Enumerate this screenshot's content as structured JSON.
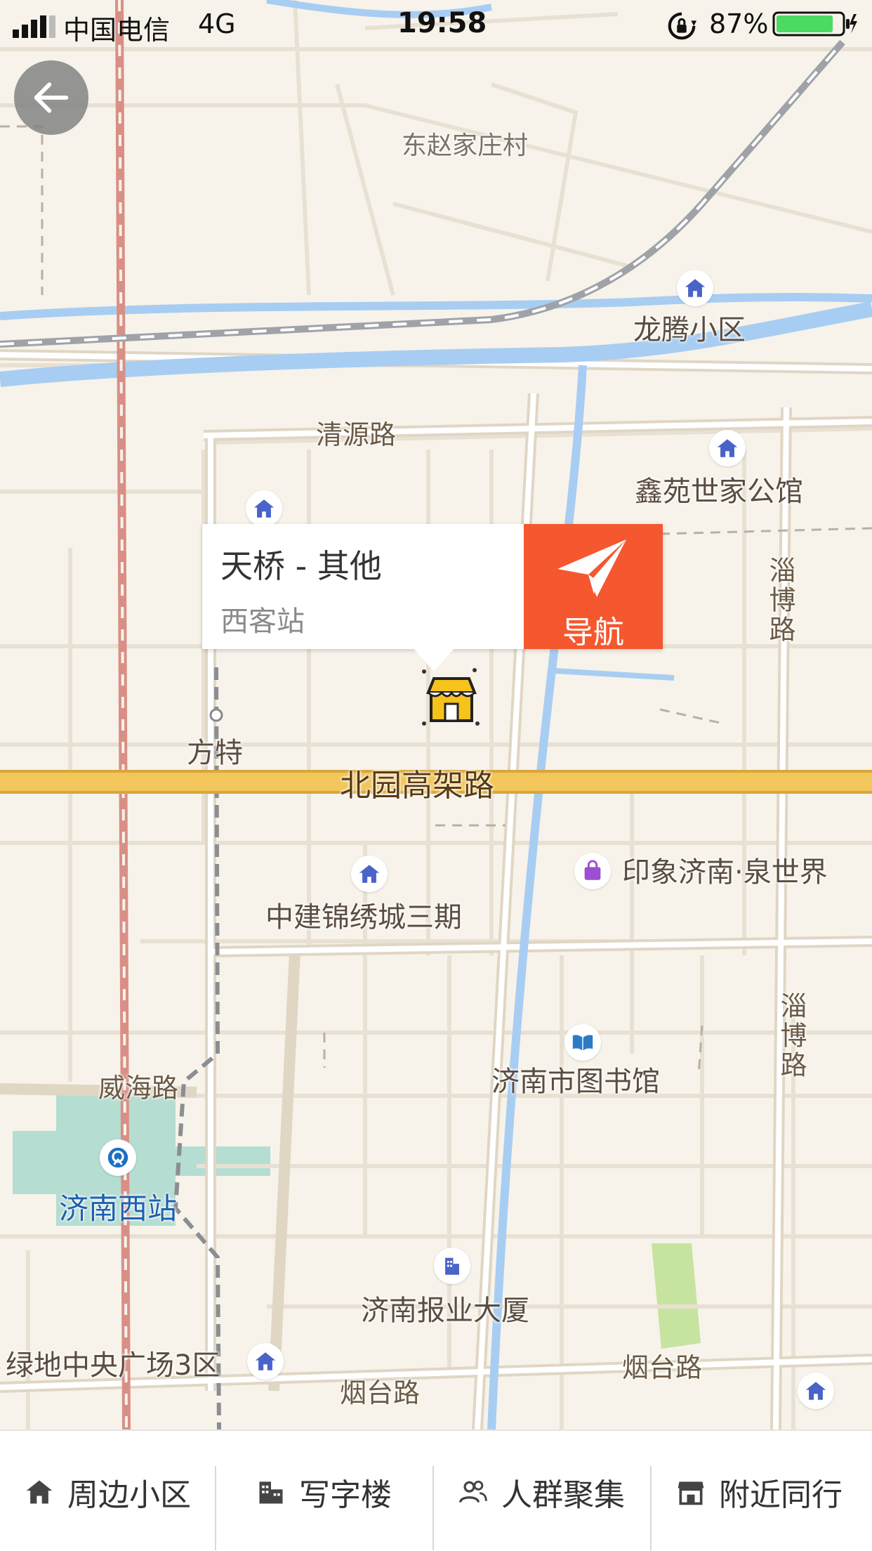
{
  "status_bar": {
    "carrier": "中国电信",
    "network": "4G",
    "time": "19:58",
    "battery_percent": "87%",
    "battery_level": 0.87
  },
  "map": {
    "labels": {
      "village": "东赵家庄村",
      "longteng": "龙腾小区",
      "qingyuan_road": "清源路",
      "xinyuan": "鑫苑世家公馆",
      "zibo_road_top": "淄博路",
      "fangte": "方特",
      "beiyuan": "北园高架路",
      "zhongjian": "中建锦绣城三期",
      "yinxiang": "印象济南·泉世界",
      "weihai_road": "威海路",
      "library": "济南市图书馆",
      "zibo_road_bottom": "淄博路",
      "west_station": "济南西站",
      "newspaper": "济南报业大厦",
      "lvdi": "绿地中央广场3区",
      "yantai_road_left": "烟台路",
      "yantai_road_right": "烟台路"
    }
  },
  "popup": {
    "title": "天桥 - 其他",
    "subtitle": "西客站",
    "nav_label": "导航"
  },
  "tabs": [
    {
      "label": "周边小区",
      "icon": "home-icon"
    },
    {
      "label": "写字楼",
      "icon": "office-building-icon"
    },
    {
      "label": "人群聚集",
      "icon": "people-icon"
    },
    {
      "label": "附近同行",
      "icon": "store-icon"
    }
  ],
  "colors": {
    "nav_button": "#f5572e",
    "highway": "#f2c65a",
    "water": "#a8cdf2",
    "railway": "#d98f86"
  }
}
